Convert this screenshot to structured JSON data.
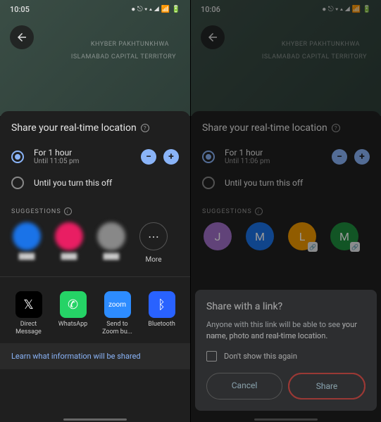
{
  "left": {
    "time": "10:05",
    "mapLabel1": "KHYBER PAKHTUNKHWA",
    "mapLabel2": "ISLAMABAD CAPITAL TERRITORY",
    "sheetTitle": "Share your real-time location",
    "option1": {
      "primary": "For 1 hour",
      "secondary": "Until 11:05 pm"
    },
    "option2": {
      "primary": "Until you turn this off"
    },
    "suggestionsLabel": "SUGGESTIONS",
    "moreLabel": "More",
    "apps": [
      {
        "name": "Direct Message"
      },
      {
        "name": "WhatsApp"
      },
      {
        "name": "Send to Zoom bu..."
      },
      {
        "name": "Bluetooth"
      }
    ],
    "footerLink": "Learn what information will be shared"
  },
  "right": {
    "time": "10:06",
    "mapLabel1": "KHYBER PAKHTUNKHWA",
    "mapLabel2": "ISLAMABAD CAPITAL TERRITORY",
    "sheetTitle": "Share your real-time location",
    "option1": {
      "primary": "For 1 hour",
      "secondary": "Until 11:06 pm"
    },
    "option2": {
      "primary": "Until you turn this off"
    },
    "suggestionsLabel": "SUGGESTIONS",
    "avatars": [
      {
        "letter": "J",
        "color": "#a26fc9"
      },
      {
        "letter": "M",
        "color": "#1a73e8"
      },
      {
        "letter": "L",
        "color": "#f29900"
      },
      {
        "letter": "M",
        "color": "#1e8e3e"
      }
    ],
    "dialog": {
      "title": "Share with a link?",
      "bodyPrefix": "Anyone with this link will be able to see ",
      "bodyBold": "your name, photo and real-time location.",
      "checkboxLabel": "Don't show this again",
      "cancelLabel": "Cancel",
      "shareLabel": "Share"
    }
  }
}
